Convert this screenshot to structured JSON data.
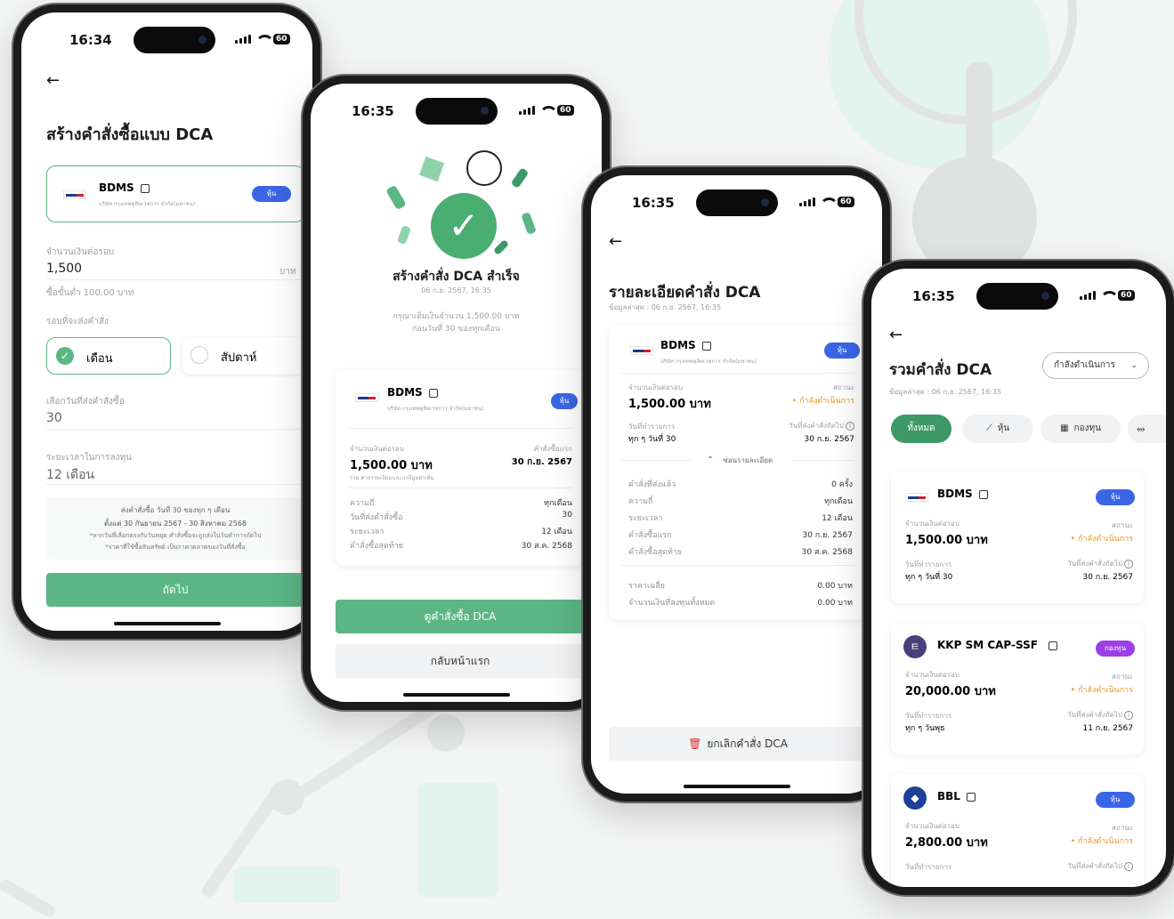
{
  "p1": {
    "time": "16:34",
    "battery": "60",
    "title": "สร้างคำสั่งซื้อแบบ DCA",
    "stock": "BDMS",
    "stock_sub": "บริษัท กรุงเทพดุสิตเวชการ จำกัด(มหาชน)",
    "badge": "หุ้น",
    "amount_label": "จำนวนเงินต่อรอบ",
    "amount": "1,500",
    "unit": "บาท",
    "min_text": "ซื้อขั้นต่ำ 100.00 บาท",
    "cycle_label": "รอบที่จะส่งคำสั่ง",
    "opt_month": "เดือน",
    "opt_week": "สัปดาห์",
    "day_label": "เลือกวันที่ส่งคำสั่งซื้อ",
    "day_value": "30",
    "period_label": "ระยะเวลาในการลงทุน",
    "period_value": "12 เดือน",
    "note1": "ส่งคำสั่งซื้อ วันที่ 30 ของทุก ๆ เดือน",
    "note2": "ตั้งแต่ 30 กันยายน 2567 - 30 สิงหาคม 2568",
    "note3": "*หากวันที่เลือกตรงกับวันหยุด คำสั่งซื้อจะถูกส่งในวันทำการถัดไป",
    "note4": "*ราคาที่ใช้ซื้อสินทรัพย์ เป็นราคาตลาดของวันที่สั่งซื้อ",
    "next": "ถัดไป"
  },
  "p2": {
    "time": "16:35",
    "battery": "60",
    "title": "สร้างคำสั่ง DCA สำเร็จ",
    "date": "06 ก.ย. 2567, 16:35",
    "msg1": "กรุณาเติมเงินจำนวน 1,500.00 บาท",
    "msg2": "ก่อนวันที่ 30 ของทุกเดือน",
    "stock": "BDMS",
    "stock_sub": "บริษัท กรุงเทพดุสิตเวชการ จำกัด(มหาชน)",
    "badge": "หุ้น",
    "amount_label": "จำนวนเงินต่อรอบ",
    "amount": "1,500.00 บาท",
    "amount_note": "รวม ค่าธรรมเนียมและภาษีมูลค่าเพิ่ม",
    "first_label": "คำสั่งซื้อแรก",
    "first_value": "30 ก.ย. 2567",
    "rows": [
      {
        "k": "ความถี่",
        "v": "ทุกเดือน"
      },
      {
        "k": "วันที่ส่งคำสั่งซื้อ",
        "v": "30"
      },
      {
        "k": "ระยะเวลา",
        "v": "12 เดือน"
      },
      {
        "k": "คำสั่งซื้อสุดท้าย",
        "v": "30 ส.ค. 2568"
      }
    ],
    "btn_view": "ดูคำสั่งซื้อ DCA",
    "btn_home": "กลับหน้าแรก"
  },
  "p3": {
    "time": "16:35",
    "battery": "60",
    "title": "รายละเอียดคำสั่ง DCA",
    "updated": "ข้อมูลล่าสุด : 06 ก.ย. 2567, 16:35",
    "stock": "BDMS",
    "stock_sub": "บริษัท กรุงเทพดุสิตเวชการ จำกัด(มหาชน)",
    "badge": "หุ้น",
    "amount_label": "จำนวนเงินต่อรอบ",
    "amount": "1,500.00 บาท",
    "status_label": "สถานะ",
    "status": "• กำลังดำเนินการ",
    "txn_label": "วันที่ทำรายการ",
    "txn_value": "ทุก ๆ วันที่ 30",
    "next_label": "วันที่ส่งคำสั่งถัดไป",
    "next_value": "30 ก.ย. 2567",
    "hide": "ซ่อนรายละเอียด",
    "rows": [
      {
        "k": "คำสั่งที่ส่งแล้ว",
        "v": "0 ครั้ง"
      },
      {
        "k": "ความถี่",
        "v": "ทุกเดือน"
      },
      {
        "k": "ระยะเวลา",
        "v": "12 เดือน"
      },
      {
        "k": "คำสั่งซื้อแรก",
        "v": "30 ก.ย. 2567"
      },
      {
        "k": "คำสั่งซื้อสุดท้าย",
        "v": "30 ส.ค. 2568"
      }
    ],
    "rows2": [
      {
        "k": "ราคาเฉลี่ย",
        "v": "0.00 บาท"
      },
      {
        "k": "จำนวนเงินที่ลงทุนทั้งหมด",
        "v": "0.00 บาท"
      }
    ],
    "cancel": "ยกเลิกคำสั่ง DCA"
  },
  "p4": {
    "time": "16:35",
    "battery": "60",
    "title": "รวมคำสั่ง DCA",
    "filter": "กำลังดำเนินการ",
    "updated": "ข้อมูลล่าสุด : 06 ก.ย. 2567, 16:35",
    "tab_all": "ทั้งหมด",
    "tab_stock": "หุ้น",
    "tab_fund": "กองทุน",
    "cards": [
      {
        "name": "BDMS",
        "badge": "หุ้น",
        "amount_label": "จำนวนเงินต่อรอบ",
        "amount": "1,500.00 บาท",
        "status_label": "สถานะ",
        "status": "• กำลังดำเนินการ",
        "txn_label": "วันที่ทำรายการ",
        "txn_value": "ทุก ๆ วันที่ 30",
        "next_label": "วันที่ส่งคำสั่งถัดไป",
        "next_value": "30 ก.ย. 2567"
      },
      {
        "name": "KKP SM CAP-SSF",
        "badge": "กองทุน",
        "amount_label": "จำนวนเงินต่อรอบ",
        "amount": "20,000.00 บาท",
        "status_label": "สถานะ",
        "status": "• กำลังดำเนินการ",
        "txn_label": "วันที่ทำรายการ",
        "txn_value": "ทุก ๆ วันพุธ",
        "next_label": "วันที่ส่งคำสั่งถัดไป",
        "next_value": "11 ก.ย. 2567"
      },
      {
        "name": "BBL",
        "badge": "หุ้น",
        "amount_label": "จำนวนเงินต่อรอบ",
        "amount": "2,800.00 บาท",
        "status_label": "สถานะ",
        "status": "• กำลังดำเนินการ",
        "txn_label": "วันที่ทำรายการ",
        "next_label": "วันที่ส่งคำสั่งถัดไป"
      }
    ]
  }
}
